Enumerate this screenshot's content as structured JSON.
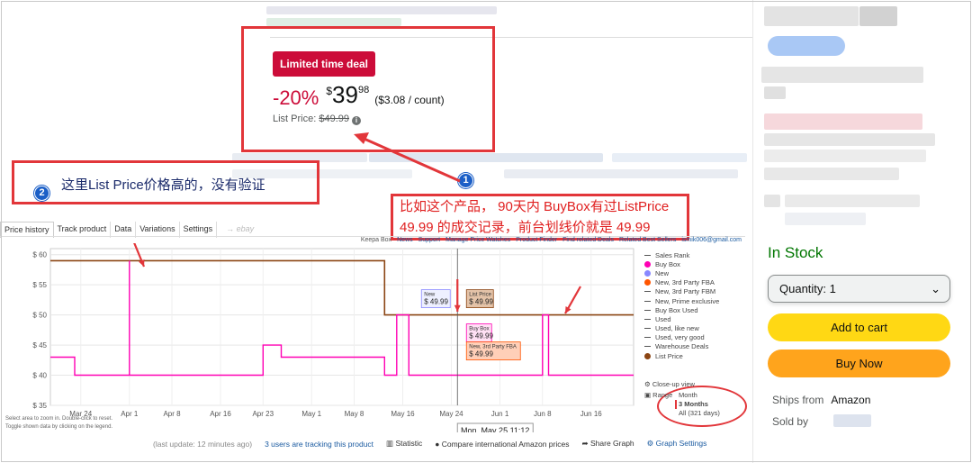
{
  "deal": {
    "badge": "Limited time deal",
    "discount": "-20%",
    "currency": "$",
    "price_whole": "39",
    "price_fraction": "98",
    "unit_price": "($3.08 / count)",
    "list_price_label": "List Price:",
    "list_price_value": "$49.99"
  },
  "annotations": {
    "note1_num": "1",
    "note1_line1": "比如这个产品， 90天内  BuyBox有过ListPrice",
    "note1_line2": "49.99 的成交记录，前台划线价就是 49.99",
    "note2_num": "2",
    "note2_text": "这里List  Price价格高的，没有验证"
  },
  "keepa": {
    "tabs": [
      "Price history",
      "Track product",
      "Data",
      "Variations",
      "Settings"
    ],
    "ebay": "ebay",
    "top_links": [
      "Keepa Box",
      "News",
      "Support",
      "Manage Price Watches",
      "Product Finder",
      "Find related Deals",
      "Related Best Sellers",
      "ismik006@gmail.com"
    ],
    "legend": [
      {
        "label": "Sales Rank",
        "color": "#555555",
        "style": "dash"
      },
      {
        "label": "Buy Box",
        "color": "#ff00b4",
        "style": "dot"
      },
      {
        "label": "New",
        "color": "#8888ff",
        "style": "dot"
      },
      {
        "label": "New, 3rd Party FBA",
        "color": "#ff5500",
        "style": "dot"
      },
      {
        "label": "New, 3rd Party FBM",
        "color": "#555555",
        "style": "dash"
      },
      {
        "label": "New, Prime exclusive",
        "color": "#555555",
        "style": "dash"
      },
      {
        "label": "Buy Box Used",
        "color": "#555555",
        "style": "dash"
      },
      {
        "label": "Used",
        "color": "#555555",
        "style": "dash"
      },
      {
        "label": "Used, like new",
        "color": "#555555",
        "style": "dash"
      },
      {
        "label": "Used, very good",
        "color": "#555555",
        "style": "dash"
      },
      {
        "label": "Warehouse Deals",
        "color": "#555555",
        "style": "dash"
      },
      {
        "label": "List Price",
        "color": "#8b4513",
        "style": "dot"
      }
    ],
    "close_up": "Close-up view",
    "range_label": "Range",
    "range_options": [
      "Month",
      "3 Months",
      "All (321 days)"
    ],
    "range_selected": "3 Months",
    "chart_hint1": "Select area to zoom in. Double-click to reset.",
    "chart_hint2": "Toggle shown data by clicking on the legend.",
    "footer": {
      "last_update": "(last update: 12 minutes ago)",
      "tracking": "3 users are tracking this product",
      "statistic": "Statistic",
      "compare": "Compare international Amazon prices",
      "share": "Share Graph",
      "settings": "Graph Settings"
    }
  },
  "chart_data": {
    "type": "line",
    "xlabel": "",
    "ylabel": "",
    "ylim": [
      35,
      61
    ],
    "y_ticks": [
      "$ 60",
      "$ 55",
      "$ 50",
      "$ 45",
      "$ 40",
      "$ 35"
    ],
    "x_ticks": [
      "Mar 24",
      "Apr 1",
      "Apr 8",
      "Apr 16",
      "Apr 23",
      "May 1",
      "May 8",
      "May 16",
      "May 24",
      "Jun 1",
      "Jun 8",
      "Jun 16"
    ],
    "series": [
      {
        "name": "List Price",
        "color": "#8b4513",
        "points": [
          [
            "Mar 19",
            59
          ],
          [
            "May 13",
            59
          ],
          [
            "May 13",
            50
          ],
          [
            "Jun 23",
            50
          ]
        ]
      },
      {
        "name": "Buy Box",
        "color": "#ff00b4",
        "points": [
          [
            "Mar 19",
            43
          ],
          [
            "Mar 23",
            43
          ],
          [
            "Mar 23",
            40
          ],
          [
            "Apr 1",
            40
          ],
          [
            "Apr 1",
            59
          ],
          [
            "Apr 1",
            40
          ],
          [
            "Apr 23",
            40
          ],
          [
            "Apr 23",
            45
          ],
          [
            "Apr 26",
            45
          ],
          [
            "Apr 26",
            43
          ],
          [
            "May 13",
            43
          ],
          [
            "May 13",
            40
          ],
          [
            "May 15",
            40
          ],
          [
            "May 15",
            50
          ],
          [
            "May 17",
            50
          ],
          [
            "May 17",
            40
          ],
          [
            "Jun 8",
            40
          ],
          [
            "Jun 8",
            50
          ],
          [
            "Jun 9",
            50
          ],
          [
            "Jun 9",
            40
          ],
          [
            "Jun 23",
            40
          ]
        ]
      }
    ],
    "tooltips": [
      {
        "label": "New",
        "value": "$ 49.99"
      },
      {
        "label": "List Price",
        "value": "$ 49.99"
      },
      {
        "label": "Buy Box",
        "value": "$ 49.99"
      },
      {
        "label": "New, 3rd Party FBA",
        "value": "$ 49.99"
      }
    ],
    "crosshair_date": "Mon, May 25 11:12"
  },
  "buybox": {
    "stock": "In Stock",
    "qty_label": "Quantity:",
    "qty_value": "1",
    "add_to_cart": "Add to cart",
    "buy_now": "Buy Now",
    "ships_from_label": "Ships from",
    "ships_from_value": "Amazon",
    "sold_by_label": "Sold by"
  }
}
